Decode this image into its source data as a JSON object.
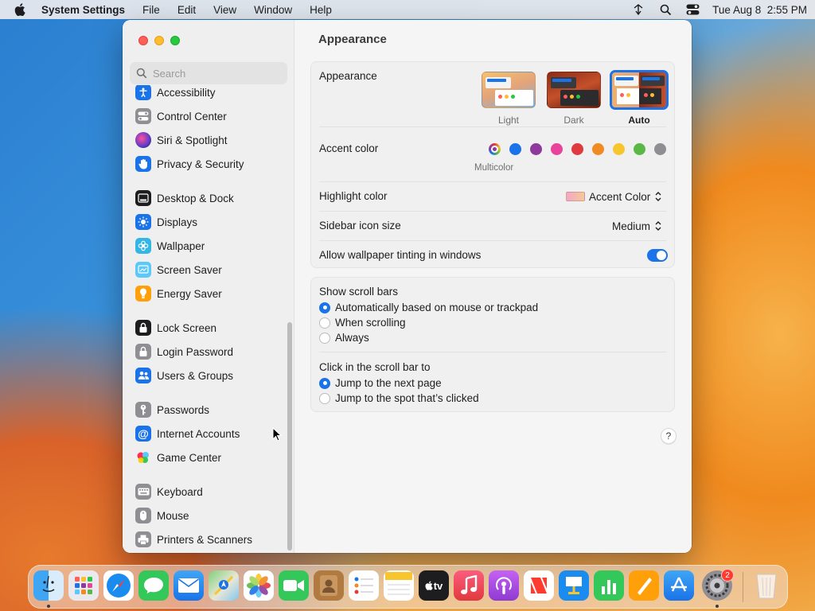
{
  "menubar": {
    "app": "System Settings",
    "items": [
      "File",
      "Edit",
      "View",
      "Window",
      "Help"
    ],
    "clock": "Tue Aug 8  2:55 PM"
  },
  "sidebar": {
    "search_placeholder": "Search",
    "items": [
      {
        "label": "Accessibility",
        "icon": "accessibility-icon",
        "color": "#1a73e8"
      },
      {
        "label": "Control Center",
        "icon": "control-center-icon",
        "color": "#8e8e93"
      },
      {
        "label": "Siri & Spotlight",
        "icon": "siri-icon",
        "color": "#5b3ac8"
      },
      {
        "label": "Privacy & Security",
        "icon": "hand-icon",
        "color": "#1a73e8"
      },
      {
        "label": "Desktop & Dock",
        "icon": "dock-icon",
        "color": "#1d1d1f"
      },
      {
        "label": "Displays",
        "icon": "sun-icon",
        "color": "#1a73e8"
      },
      {
        "label": "Wallpaper",
        "icon": "flower-icon",
        "color": "#33b5e5"
      },
      {
        "label": "Screen Saver",
        "icon": "screen-saver-icon",
        "color": "#5ac8fa"
      },
      {
        "label": "Energy Saver",
        "icon": "battery-icon",
        "color": "#ff9f0a"
      },
      {
        "label": "Lock Screen",
        "icon": "lock-icon",
        "color": "#1d1d1f"
      },
      {
        "label": "Login Password",
        "icon": "padlock-icon",
        "color": "#8e8e93"
      },
      {
        "label": "Users & Groups",
        "icon": "users-icon",
        "color": "#1a73e8"
      },
      {
        "label": "Passwords",
        "icon": "key-icon",
        "color": "#8e8e93"
      },
      {
        "label": "Internet Accounts",
        "icon": "at-icon",
        "color": "#1a73e8"
      },
      {
        "label": "Game Center",
        "icon": "game-center-icon",
        "color": "#ff2d55"
      },
      {
        "label": "Keyboard",
        "icon": "keyboard-icon",
        "color": "#8e8e93"
      },
      {
        "label": "Mouse",
        "icon": "mouse-icon",
        "color": "#8e8e93"
      },
      {
        "label": "Printers & Scanners",
        "icon": "printer-icon",
        "color": "#8e8e93"
      }
    ]
  },
  "content": {
    "title": "Appearance",
    "appearance": {
      "label": "Appearance",
      "options": [
        "Light",
        "Dark",
        "Auto"
      ],
      "selected": "Auto"
    },
    "accent": {
      "label": "Accent color",
      "caption": "Multicolor",
      "colors": [
        "multicolor",
        "#1a73e8",
        "#8e3a9d",
        "#e8449b",
        "#e0393e",
        "#f28a22",
        "#f7c62e",
        "#5cb846",
        "#8e8e93"
      ]
    },
    "highlight": {
      "label": "Highlight color",
      "value": "Accent Color"
    },
    "sidebar_icon_size": {
      "label": "Sidebar icon size",
      "value": "Medium"
    },
    "tinting": {
      "label": "Allow wallpaper tinting in windows",
      "enabled": true
    },
    "scroll_bars": {
      "label": "Show scroll bars",
      "options": [
        "Automatically based on mouse or trackpad",
        "When scrolling",
        "Always"
      ],
      "selected": 0
    },
    "click_scroll": {
      "label": "Click in the scroll bar to",
      "options": [
        "Jump to the next page",
        "Jump to the spot that’s clicked"
      ],
      "selected": 0
    },
    "help": "?"
  },
  "dock": {
    "apps": [
      "Finder",
      "Launchpad",
      "Safari",
      "Messages",
      "Mail",
      "Maps",
      "Photos",
      "FaceTime",
      "Contacts",
      "Reminders",
      "Notes",
      "TV",
      "Music",
      "Podcasts",
      "News",
      "Keynote",
      "Numbers",
      "Pages",
      "App Store",
      "System Settings",
      "Trash"
    ],
    "badge": "2",
    "tv_label": "tv"
  }
}
